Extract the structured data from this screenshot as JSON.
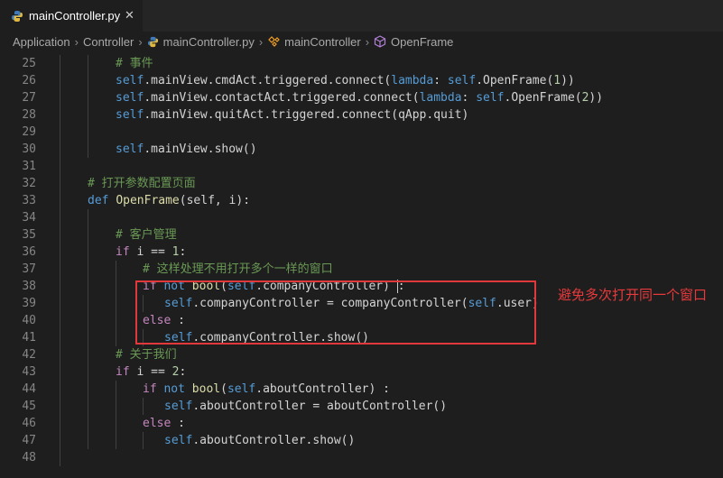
{
  "tab": {
    "filename": "mainController.py",
    "close": "✕"
  },
  "breadcrumb": {
    "items": [
      "Application",
      "Controller",
      "mainController.py",
      "mainController",
      "OpenFrame"
    ],
    "separator": "›"
  },
  "editor": {
    "line_numbers": [
      "25",
      "26",
      "27",
      "28",
      "29",
      "30",
      "31",
      "32",
      "33",
      "34",
      "35",
      "36",
      "37",
      "38",
      "39",
      "40",
      "41",
      "42",
      "43",
      "44",
      "45",
      "46",
      "47",
      "48"
    ],
    "lines": [
      [
        {
          "t": "# 事件",
          "c": "cmt"
        }
      ],
      [
        {
          "t": "self",
          "c": "kw"
        },
        {
          "t": ".mainView.cmdAct.triggered.connect(",
          "c": ""
        },
        {
          "t": "lambda",
          "c": "kw"
        },
        {
          "t": ": ",
          "c": ""
        },
        {
          "t": "self",
          "c": "kw"
        },
        {
          "t": ".OpenFrame(",
          "c": ""
        },
        {
          "t": "1",
          "c": "num"
        },
        {
          "t": "))",
          "c": ""
        }
      ],
      [
        {
          "t": "self",
          "c": "kw"
        },
        {
          "t": ".mainView.contactAct.triggered.connect(",
          "c": ""
        },
        {
          "t": "lambda",
          "c": "kw"
        },
        {
          "t": ": ",
          "c": ""
        },
        {
          "t": "self",
          "c": "kw"
        },
        {
          "t": ".OpenFrame(",
          "c": ""
        },
        {
          "t": "2",
          "c": "num"
        },
        {
          "t": "))",
          "c": ""
        }
      ],
      [
        {
          "t": "self",
          "c": "kw"
        },
        {
          "t": ".mainView.quitAct.triggered.connect(qApp.quit)",
          "c": ""
        }
      ],
      [],
      [
        {
          "t": "self",
          "c": "kw"
        },
        {
          "t": ".mainView.show()",
          "c": ""
        }
      ],
      [],
      [
        {
          "t": "# 打开参数配置页面",
          "c": "cmt"
        }
      ],
      [
        {
          "t": "def ",
          "c": "kw"
        },
        {
          "t": "OpenFrame",
          "c": "fn"
        },
        {
          "t": "(self, i):",
          "c": ""
        }
      ],
      [],
      [
        {
          "t": "# 客户管理",
          "c": "cmt"
        }
      ],
      [
        {
          "t": "if ",
          "c": "ctl"
        },
        {
          "t": "i == ",
          "c": ""
        },
        {
          "t": "1",
          "c": "num"
        },
        {
          "t": ":",
          "c": ""
        }
      ],
      [
        {
          "t": "# 这样处理不用打开多个一样的窗口",
          "c": "cmt"
        }
      ],
      [
        {
          "t": "if ",
          "c": "ctl"
        },
        {
          "t": "not ",
          "c": "kw"
        },
        {
          "t": "bool",
          "c": "fn"
        },
        {
          "t": "(",
          "c": ""
        },
        {
          "t": "self",
          "c": "kw"
        },
        {
          "t": ".companyController) ",
          "c": ""
        },
        {
          "t": "|",
          "c": "cursor"
        },
        {
          "t": ":",
          "c": ""
        }
      ],
      [
        {
          "t": "self",
          "c": "kw"
        },
        {
          "t": ".companyController = companyController(",
          "c": ""
        },
        {
          "t": "self",
          "c": "kw"
        },
        {
          "t": ".user)",
          "c": ""
        }
      ],
      [
        {
          "t": "else ",
          "c": "ctl"
        },
        {
          "t": ":",
          "c": ""
        }
      ],
      [
        {
          "t": "self",
          "c": "kw"
        },
        {
          "t": ".companyController.show()",
          "c": ""
        }
      ],
      [
        {
          "t": "# 关于我们",
          "c": "cmt"
        }
      ],
      [
        {
          "t": "if ",
          "c": "ctl"
        },
        {
          "t": "i == ",
          "c": ""
        },
        {
          "t": "2",
          "c": "num"
        },
        {
          "t": ":",
          "c": ""
        }
      ],
      [
        {
          "t": "if ",
          "c": "ctl"
        },
        {
          "t": "not ",
          "c": "kw"
        },
        {
          "t": "bool",
          "c": "fn"
        },
        {
          "t": "(",
          "c": ""
        },
        {
          "t": "self",
          "c": "kw"
        },
        {
          "t": ".aboutController) :",
          "c": ""
        }
      ],
      [
        {
          "t": "self",
          "c": "kw"
        },
        {
          "t": ".aboutController = aboutController()",
          "c": ""
        }
      ],
      [
        {
          "t": "else ",
          "c": "ctl"
        },
        {
          "t": ":",
          "c": ""
        }
      ],
      [
        {
          "t": "self",
          "c": "kw"
        },
        {
          "t": ".aboutController.show()",
          "c": ""
        }
      ],
      []
    ]
  },
  "annotation": {
    "text": "避免多次打开同一个窗口"
  },
  "colors": {
    "annotation": "#e0383b",
    "background": "#1e1e1e"
  }
}
